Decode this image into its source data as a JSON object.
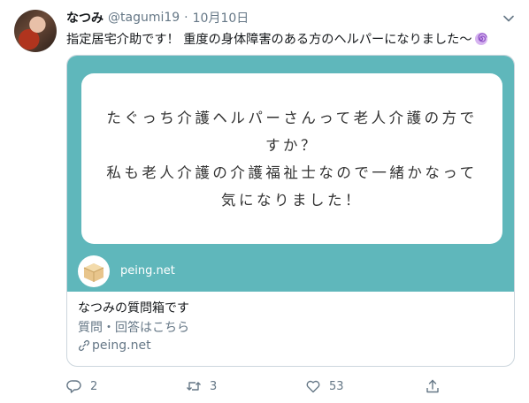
{
  "tweet": {
    "display_name": "なつみ",
    "handle": "@tagumi19",
    "separator": "·",
    "date": "10月10日",
    "text": "指定居宅介助です！ 重度の身体障害のある方のヘルパーになりました〜"
  },
  "card": {
    "question_lines": [
      "たぐっち介護ヘルパーさんって老人介護の方で",
      "すか？",
      "私も老人介護の介護福祉士なので一緒かなって",
      "気になりました！"
    ],
    "image_site_label": "peing.net",
    "title": "なつみの質問箱です",
    "description": "質問・回答はこちら",
    "domain": "peing.net",
    "image_bg_color": "#5fb7bb"
  },
  "actions": {
    "reply_count": "2",
    "retweet_count": "3",
    "like_count": "53"
  },
  "icons": [
    "chevron-down-icon",
    "swirl-emoji-icon",
    "link-icon",
    "reply-icon",
    "retweet-icon",
    "like-icon",
    "share-icon",
    "box-icon"
  ]
}
